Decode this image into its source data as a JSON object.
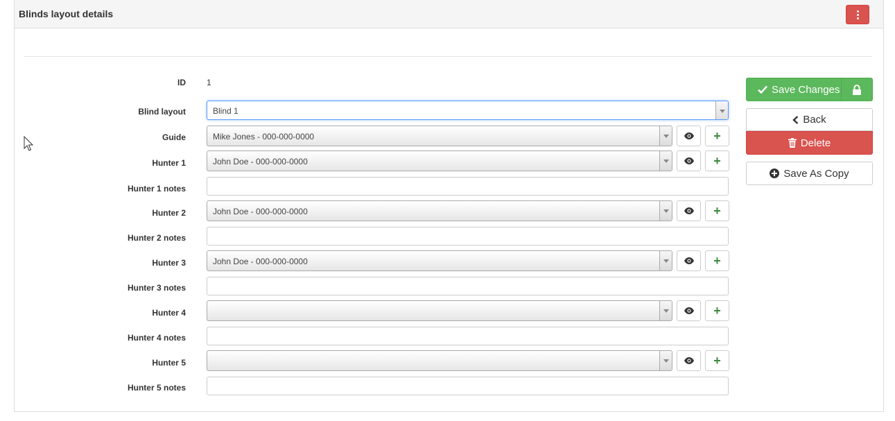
{
  "panel": {
    "title": "Blinds layout details"
  },
  "form": {
    "id_label": "ID",
    "id_value": "1",
    "blind_layout": {
      "label": "Blind layout",
      "value": "Blind 1"
    },
    "guide": {
      "label": "Guide",
      "value": "Mike Jones - 000-000-0000"
    },
    "hunters": [
      {
        "label": "Hunter 1",
        "value": "John Doe - 000-000-0000",
        "notes_label": "Hunter 1 notes",
        "notes_value": ""
      },
      {
        "label": "Hunter 2",
        "value": "John Doe - 000-000-0000",
        "notes_label": "Hunter 2 notes",
        "notes_value": ""
      },
      {
        "label": "Hunter 3",
        "value": "John Doe - 000-000-0000",
        "notes_label": "Hunter 3 notes",
        "notes_value": ""
      },
      {
        "label": "Hunter 4",
        "value": "",
        "notes_label": "Hunter 4 notes",
        "notes_value": ""
      },
      {
        "label": "Hunter 5",
        "value": "",
        "notes_label": "Hunter 5 notes",
        "notes_value": ""
      }
    ]
  },
  "actions": {
    "save_changes": "Save Changes",
    "back": "Back",
    "delete": "Delete",
    "save_as_copy": "Save As Copy"
  },
  "colors": {
    "success": "#5cb85c",
    "danger": "#d9534f",
    "focus": "#5897fb"
  }
}
